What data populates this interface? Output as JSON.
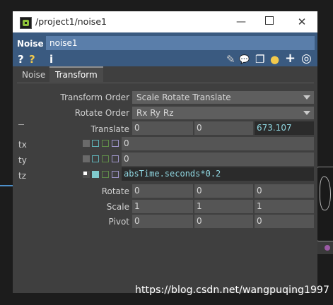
{
  "window": {
    "title": "/project1/noise1",
    "min_label": "—",
    "close_label": "✕"
  },
  "op": {
    "type": "Noise",
    "name": "noise1"
  },
  "toolbar_icons": [
    "help-icon",
    "python-help-icon",
    "info-icon",
    "edit-icon",
    "comment-icon",
    "clone-icon",
    "python-icon",
    "add-icon",
    "target-icon"
  ],
  "toolbar_glyphs": {
    "help": "?",
    "python_help": "?",
    "info": "i",
    "edit": "✎",
    "comment": "💬",
    "clone": "❐",
    "python": "●",
    "add": "+",
    "target": "◎"
  },
  "tabs": [
    {
      "label": "Noise"
    },
    {
      "label": "Transform"
    }
  ],
  "params": {
    "transform_order": {
      "label": "Transform Order",
      "value": "Scale Rotate Translate"
    },
    "rotate_order": {
      "label": "Rotate Order",
      "value": "Rx Ry Rz"
    },
    "translate": {
      "label": "Translate",
      "x": "0",
      "y": "0",
      "z": "673.107"
    },
    "tx": {
      "label": "tx",
      "value": "0"
    },
    "ty": {
      "label": "ty",
      "value": "0"
    },
    "tz": {
      "label": "tz",
      "value": "absTime.seconds*0.2"
    },
    "rotate": {
      "label": "Rotate",
      "x": "0",
      "y": "0",
      "z": "0"
    },
    "scale": {
      "label": "Scale",
      "x": "1",
      "y": "1",
      "z": "1"
    },
    "pivot": {
      "label": "Pivot",
      "x": "0",
      "y": "0",
      "z": "0"
    }
  },
  "watermark": "https://blog.csdn.net/wangpuqing1997",
  "colors": {
    "header": "#3a5a80",
    "name_field": "#5a7eaa",
    "panel": "#3f3f3f",
    "expression_text": "#8fd6e0"
  }
}
